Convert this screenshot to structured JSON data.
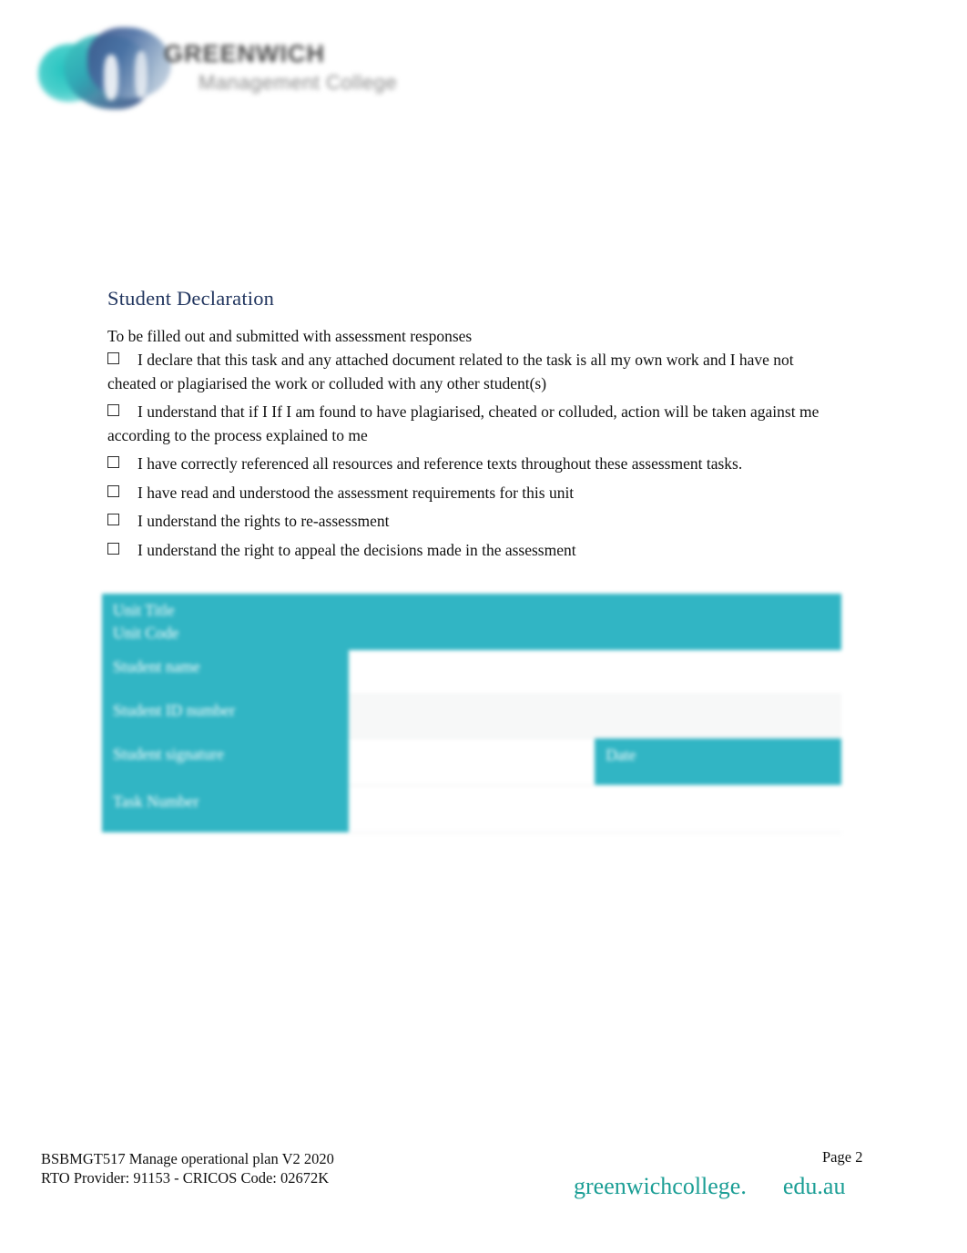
{
  "document": {
    "logo": {
      "mark_icon": "greenwich-gm-logo-icon",
      "word_top": "GREENWICH",
      "word_bottom": "Management College"
    },
    "heading": "Student Declaration",
    "intro": "To be filled out and submitted with assessment responses",
    "declarations": [
      "I declare that this task and any attached document related to the task is all my own work and I have not cheated or plagiarised the work or colluded with any other student(s)",
      "I understand that if I If I am found to have plagiarised, cheated or colluded, action will be taken against me according to the process explained to me",
      "I have correctly referenced all resources and reference texts throughout these assessment tasks.",
      "I have read and understood the assessment requirements for this unit",
      "I understand the rights to re-assessment",
      "I understand the right to appeal the decisions made in the assessment"
    ],
    "table": {
      "unit_title_label": "Unit Title",
      "unit_code_label": "Unit Code",
      "student_name_label": "Student name",
      "student_id_label": "Student ID number",
      "student_signature_label": "Student signature",
      "date_label": "Date",
      "task_number_label": "Task Number",
      "unit_title_value": "",
      "unit_code_value": "",
      "student_name_value": "",
      "student_id_value": "",
      "student_signature_value": "",
      "date_value": "",
      "task_number_value": "",
      "task_number_value_2": ""
    },
    "footer": {
      "unit_line": "BSBMGT517 Manage operational plan V2 2020",
      "rto_line": "RTO Provider: 91153     - CRICOS  Code: 02672K",
      "page_label": "Page 2",
      "brand_name": "greenwichcollege.",
      "brand_tld": "edu.au"
    },
    "colors": {
      "teal": "#31b5c4",
      "heading_navy": "#22365f",
      "brand_teal": "#1b9e95"
    }
  }
}
